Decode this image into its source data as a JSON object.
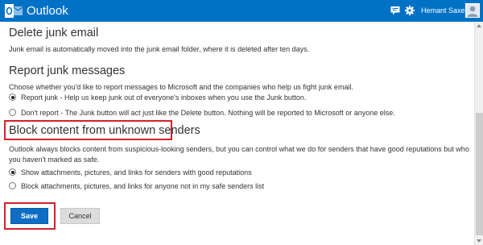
{
  "header": {
    "brand": "Outlook",
    "user_name": "Hemant Saxena",
    "icons": [
      "outlook-logo",
      "chat-icon",
      "gear-icon",
      "avatar"
    ]
  },
  "sections": {
    "delete_junk": {
      "title": "Delete junk email",
      "description": "Junk email is automatically moved into the junk email folder, where it is deleted after ten days."
    },
    "report_junk": {
      "title": "Report junk messages",
      "description": "Choose whether you'd like to report messages to Microsoft and the companies who help us fight junk email.",
      "options": [
        {
          "label": "Report junk - Help us keep junk out of everyone's inboxes when you use the Junk button.",
          "selected": true
        },
        {
          "label": "Don't report - The Junk button will act just like the Delete button. Nothing will be reported to Microsoft or anyone else.",
          "selected": false
        }
      ]
    },
    "block_content": {
      "title": "Block content from unknown senders",
      "description": "Outlook always blocks content from suspicious-looking senders, but you can control what we do for senders that have good reputations but who you haven't marked as safe.",
      "options": [
        {
          "label": "Show attachments, pictures, and links for senders with good reputations",
          "selected": true
        },
        {
          "label": "Block attachments, pictures, and links for anyone not in my safe senders list",
          "selected": false
        }
      ]
    }
  },
  "buttons": {
    "save": "Save",
    "cancel": "Cancel"
  },
  "colors": {
    "header_bg": "#0072c6",
    "save_bg": "#0f6ec4",
    "highlight_box": "#d3222a"
  }
}
